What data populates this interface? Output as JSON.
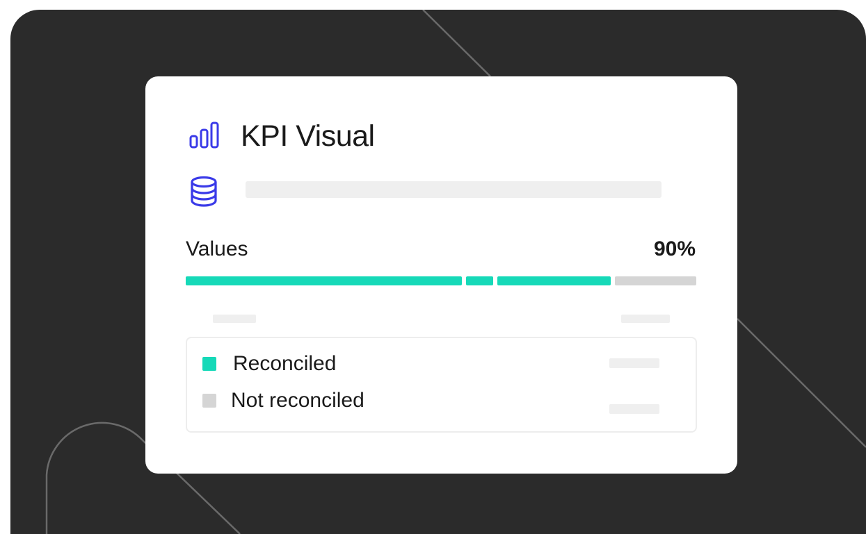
{
  "card": {
    "title": "KPI Visual",
    "title_icon": "bar-chart-icon",
    "data_icon": "database-icon"
  },
  "values": {
    "label": "Values",
    "percent": "90%",
    "progress_fraction": 0.9
  },
  "legend": {
    "items": [
      {
        "label": "Reconciled",
        "color": "#16d9b8"
      },
      {
        "label": "Not reconciled",
        "color": "#d5d5d5"
      }
    ]
  },
  "colors": {
    "accent": "#3a3ae8",
    "reconciled": "#16d9b8",
    "not_reconciled": "#d5d5d5",
    "background": "#2b2b2b"
  }
}
